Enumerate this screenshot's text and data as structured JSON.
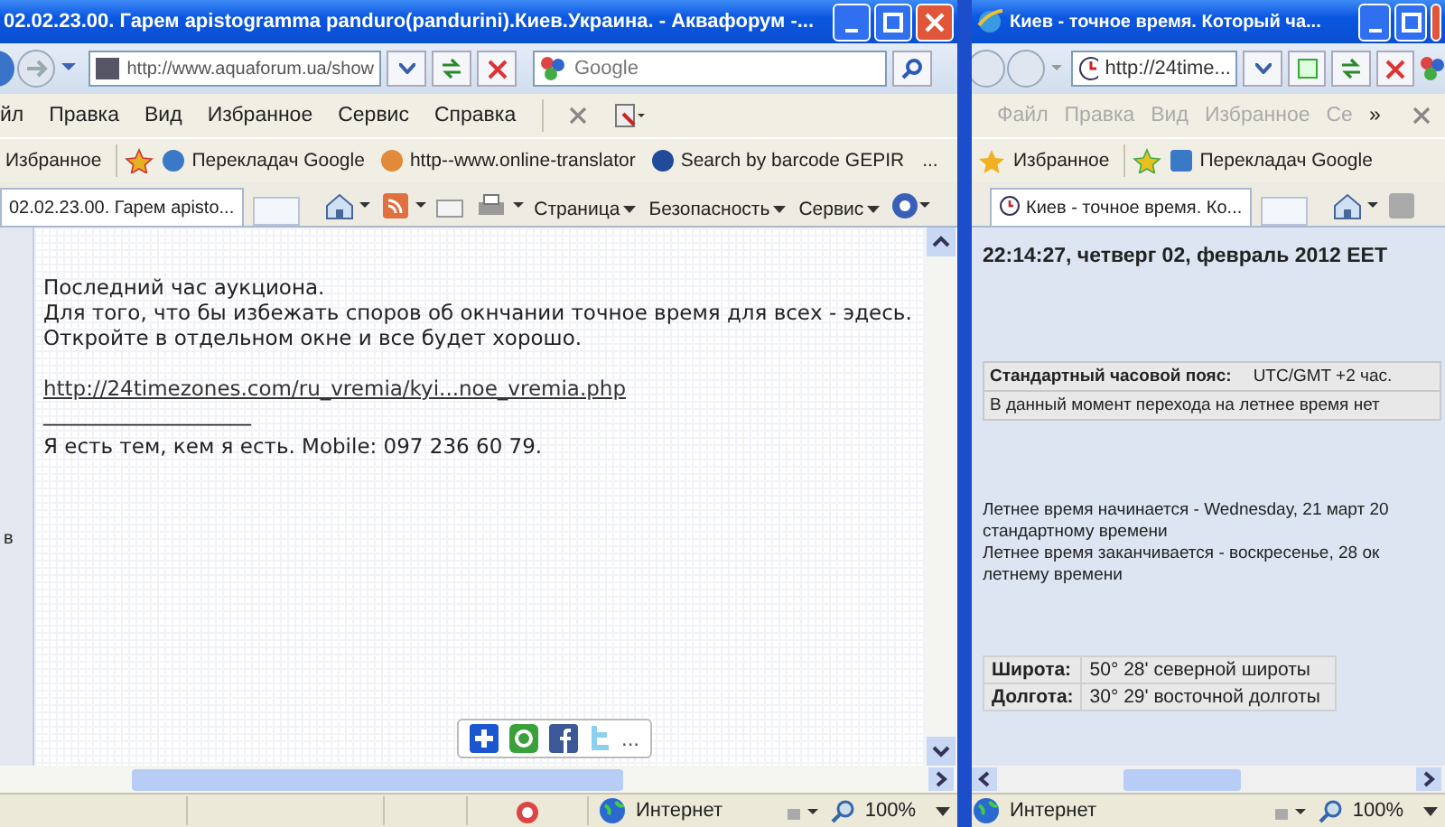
{
  "left_window": {
    "title": "02.02.23.00. Гарем apistogramma panduro(pandurini).Киев.Украина. - Аквафорум -...",
    "address": "http://www.aquaforum.ua/show",
    "search": {
      "placeholder": "Google"
    },
    "menu": [
      "йл",
      "Правка",
      "Вид",
      "Избранное",
      "Сервис",
      "Справка"
    ],
    "favorites_label": "Избранное",
    "favorites": [
      "Перекладач Google",
      "http--www.online-translator",
      "Search by barcode  GEPIR"
    ],
    "favorites_more": "...",
    "tabs": [
      {
        "label": "02.02.23.00. Гарем apisto...",
        "selected": true
      }
    ],
    "commands": [
      "Страница",
      "Безопасность",
      "Сервис"
    ],
    "gutter_text": "в",
    "post_lines": [
      "Последний час аукциона.",
      "Для того, что бы избежать споров об окнчании точное время для всех - эдесь.",
      "Откройте в отдельном окне и все будет хорошо."
    ],
    "link": "http://24timezones.com/ru_vremia/kyi...noe_vremia.php",
    "signature_rule": "____________________",
    "signature": "Я есть тем, кем я есть. Mobile: 097 236 60 79.",
    "share_more": "...",
    "status": "Интернет",
    "zoom": "100%"
  },
  "right_window": {
    "title": "Киев - точное время. Который ча...",
    "address": "http://24time...",
    "menu": [
      {
        "label": "Файл",
        "disabled": true
      },
      {
        "label": "Правка",
        "disabled": true
      },
      {
        "label": "Вид",
        "disabled": true
      },
      {
        "label": "Избранное",
        "disabled": true
      },
      {
        "label": "Се",
        "disabled": true
      }
    ],
    "menu_more": "»",
    "favorites_label": "Избранное",
    "favorites": [
      "Перекладач Google"
    ],
    "tabs": [
      {
        "label": "Киев - точное время. Ко...",
        "selected": true
      }
    ],
    "clock": "22:14:27, четверг 02, февраль 2012 EET",
    "zone_label": "Стандартный часовой пояс:",
    "zone_value": "UTC/GMT +2 час.",
    "dst_note": "В данный момент перехода на летнее время нет",
    "dst_lines": [
      "Летнее время начинается - Wednesday, 21 март 20",
      "стандартному времени",
      "Летнее время заканчивается - воскресенье, 28 ок",
      "летнему времени"
    ],
    "coords": [
      {
        "label": "Широта:",
        "value": "50° 28' северной широты"
      },
      {
        "label": "Долгота:",
        "value": "30° 29' восточной долготы"
      }
    ],
    "status": "Интернет",
    "zoom": "100%"
  }
}
